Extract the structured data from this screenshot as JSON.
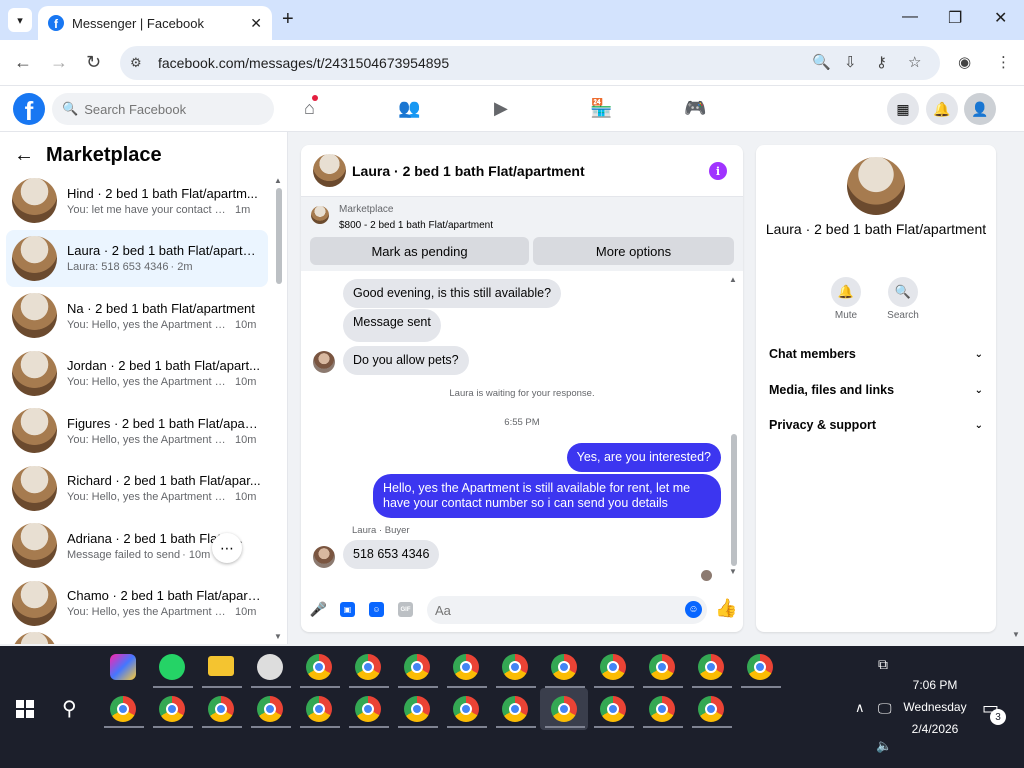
{
  "browser": {
    "tab_title": "Messenger | Facebook",
    "url": "facebook.com/messages/t/2431504673954895"
  },
  "fb": {
    "search_placeholder": "Search Facebook"
  },
  "left": {
    "title": "Marketplace",
    "chats": [
      {
        "name": "Hind · 2 bed 1 bath Flat/apartm...",
        "preview": "You: let me have your contact nu...",
        "time": "1m"
      },
      {
        "name": "Laura · 2 bed 1 bath Flat/apartm...",
        "preview": "Laura: 518 653 4346",
        "time": "· 2m"
      },
      {
        "name": "Na · 2 bed 1 bath Flat/apartment",
        "preview": "You: Hello, yes the Apartment is ...",
        "time": "10m"
      },
      {
        "name": "Jordan · 2 bed 1 bath Flat/apart...",
        "preview": "You: Hello, yes the Apartment is ...",
        "time": "10m"
      },
      {
        "name": "Figures · 2 bed 1 bath Flat/apart...",
        "preview": "You: Hello, yes the Apartment is ...",
        "time": "10m"
      },
      {
        "name": "Richard · 2 bed 1 bath Flat/apar...",
        "preview": "You: Hello, yes the Apartment is ...",
        "time": "10m"
      },
      {
        "name": "Adriana · 2 bed 1 bath Flat/a...",
        "preview": "Message failed to send",
        "time": "· 10m"
      },
      {
        "name": "Chamo · 2 bed 1 bath Flat/apart...",
        "preview": "You: Hello, yes the Apartment is ...",
        "time": "10m"
      }
    ]
  },
  "conv": {
    "title": "Laura · 2 bed 1 bath Flat/apartment",
    "marketplace_label": "Marketplace",
    "listing": "$800 - 2 bed 1 bath Flat/apartment",
    "btn_pending": "Mark as pending",
    "btn_more": "More options",
    "msg1": "Good evening, is this still available?",
    "msg2": "Message sent",
    "msg3": "Do you allow pets?",
    "waiting": "Laura is waiting for your response.",
    "timestamp": "6:55 PM",
    "msg4": "Yes, are you interested?",
    "msg5": "Hello, yes the Apartment is still available for rent, let me have your contact number so i can send you details",
    "sender_label": "Laura · Buyer",
    "msg6": "518 653 4346",
    "input_placeholder": "Aa",
    "gif_label": "GIF"
  },
  "right": {
    "name": "Laura · 2 bed 1 bath Flat/apartment",
    "mute": "Mute",
    "search": "Search",
    "rows": [
      "Chat members",
      "Media, files and links",
      "Privacy & support"
    ]
  },
  "taskbar": {
    "time": "7:06 PM",
    "day": "Wednesday",
    "date": "2/4/2026",
    "notif_count": "3"
  },
  "colors": {
    "accent": "#0866ff",
    "outgoing_bubble": "#3c36f0",
    "info_icon": "#a033ff",
    "active_chat": "#ebf5ff"
  }
}
